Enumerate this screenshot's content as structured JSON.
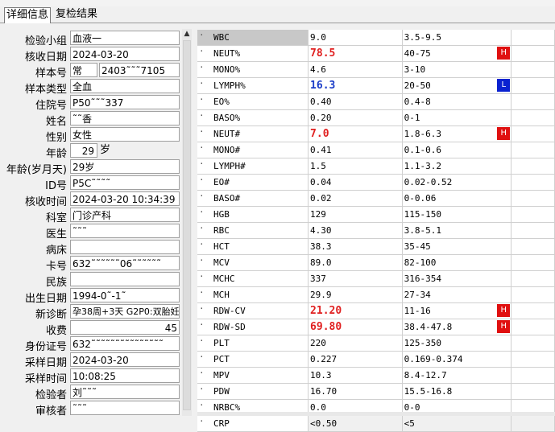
{
  "tabs": [
    {
      "label": "详细信息"
    },
    {
      "label": "复检结果"
    }
  ],
  "info": {
    "group": {
      "label": "检验小组",
      "value": "血液一"
    },
    "receive_date": {
      "label": "核收日期",
      "value": "2024-03-20"
    },
    "sample_no": {
      "label": "样本号",
      "value": "常",
      "value2": "2403˜˜˜7105"
    },
    "sample_type": {
      "label": "样本类型",
      "value": "全血"
    },
    "inpatient_no": {
      "label": "住院号",
      "value": "P50˜˜˜337"
    },
    "name": {
      "label": "姓名",
      "value": "˜˜香"
    },
    "sex": {
      "label": "性别",
      "value": "女性"
    },
    "age": {
      "label": "年龄",
      "value": "29",
      "unit": "岁"
    },
    "age_ymd": {
      "label": "年龄(岁月天)",
      "value": "29岁"
    },
    "id_no": {
      "label": "ID号",
      "value": "P5C˜˜˜˜"
    },
    "receive_time": {
      "label": "核收时间",
      "value": "2024-03-20 10:34:39"
    },
    "department": {
      "label": "科室",
      "value": "门诊产科"
    },
    "doctor": {
      "label": "医生",
      "value": "˜˜˜"
    },
    "bed": {
      "label": "病床",
      "value": ""
    },
    "card_no": {
      "label": "卡号",
      "value": "632˜˜˜˜˜˜06˜˜˜˜˜˜"
    },
    "ethnicity": {
      "label": "民族",
      "value": ""
    },
    "birth_date": {
      "label": "出生日期",
      "value": "1994-0˜-1˜"
    },
    "new_diagnosis": {
      "label": "新诊断",
      "value": "孕38周+3天 G2P0:双胎妊"
    },
    "fee": {
      "label": "收费",
      "value": "45"
    },
    "id_card": {
      "label": "身份证号",
      "value": "632˜˜˜˜˜˜˜˜˜˜˜˜˜˜˜"
    },
    "collect_date": {
      "label": "采样日期",
      "value": "2024-03-20"
    },
    "collect_time": {
      "label": "采样时间",
      "value": "10:08:25"
    },
    "tester": {
      "label": "检验者",
      "value": "刘˜˜˜"
    },
    "reviewer": {
      "label": "审核者",
      "value": "˜˜˜"
    }
  },
  "results": [
    {
      "code": "WBC",
      "value": "9.0",
      "range": "3.5-9.5",
      "flag": ""
    },
    {
      "code": "NEUT%",
      "value": "78.5",
      "range": "40-75",
      "flag": "H"
    },
    {
      "code": "MONO%",
      "value": "4.6",
      "range": "3-10",
      "flag": ""
    },
    {
      "code": "LYMPH%",
      "value": "16.3",
      "range": "20-50",
      "flag": "L"
    },
    {
      "code": "EO%",
      "value": "0.40",
      "range": "0.4-8",
      "flag": ""
    },
    {
      "code": "BASO%",
      "value": "0.20",
      "range": "0-1",
      "flag": ""
    },
    {
      "code": "NEUT#",
      "value": "7.0",
      "range": "1.8-6.3",
      "flag": "H"
    },
    {
      "code": "MONO#",
      "value": "0.41",
      "range": "0.1-0.6",
      "flag": ""
    },
    {
      "code": "LYMPH#",
      "value": "1.5",
      "range": "1.1-3.2",
      "flag": ""
    },
    {
      "code": "EO#",
      "value": "0.04",
      "range": "0.02-0.52",
      "flag": ""
    },
    {
      "code": "BASO#",
      "value": "0.02",
      "range": "0-0.06",
      "flag": ""
    },
    {
      "code": "HGB",
      "value": "129",
      "range": "115-150",
      "flag": ""
    },
    {
      "code": "RBC",
      "value": "4.30",
      "range": "3.8-5.1",
      "flag": ""
    },
    {
      "code": "HCT",
      "value": "38.3",
      "range": "35-45",
      "flag": ""
    },
    {
      "code": "MCV",
      "value": "89.0",
      "range": "82-100",
      "flag": ""
    },
    {
      "code": "MCHC",
      "value": "337",
      "range": "316-354",
      "flag": ""
    },
    {
      "code": "MCH",
      "value": "29.9",
      "range": "27-34",
      "flag": ""
    },
    {
      "code": "RDW-CV",
      "value": "21.20",
      "range": "11-16",
      "flag": "H"
    },
    {
      "code": "RDW-SD",
      "value": "69.80",
      "range": "38.4-47.8",
      "flag": "H"
    },
    {
      "code": "PLT",
      "value": "220",
      "range": "125-350",
      "flag": ""
    },
    {
      "code": "PCT",
      "value": "0.227",
      "range": "0.169-0.374",
      "flag": ""
    },
    {
      "code": "MPV",
      "value": "10.3",
      "range": "8.4-12.7",
      "flag": ""
    },
    {
      "code": "PDW",
      "value": "16.70",
      "range": "15.5-16.8",
      "flag": ""
    },
    {
      "code": "NRBC%",
      "value": "0.0",
      "range": "0-0",
      "flag": ""
    },
    {
      "code": "CRP",
      "value": "<0.50",
      "range": "<5",
      "flag": ""
    }
  ],
  "colors": {
    "high": "#e02020",
    "low": "#1a3cc8",
    "flag_h_bg": "#e01010",
    "flag_l_bg": "#0a22d0"
  }
}
